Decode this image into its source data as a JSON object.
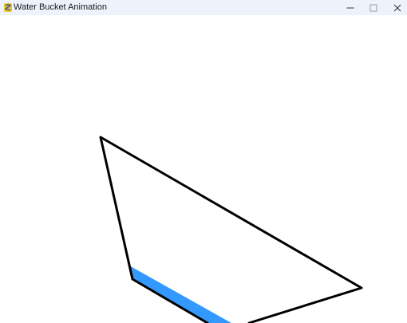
{
  "window": {
    "title": "Water Bucket Animation",
    "app_icon": "pygame-snake-icon",
    "controls": {
      "minimize_icon": "minimize-icon",
      "maximize_icon": "maximize-icon",
      "close_icon": "close-icon"
    }
  },
  "scene": {
    "bucket_outline_color": "#000000",
    "water_color": "#3399ff",
    "background_color": "#ffffff"
  }
}
